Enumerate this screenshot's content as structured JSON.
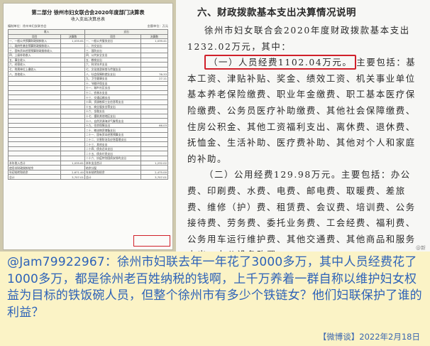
{
  "left_document": {
    "title": "第二部分 徐州市妇女联合会2020年度部门决算表",
    "subtitle": "收入支出决算总表",
    "meta_left": "编制单位：徐州市妇女联合会",
    "meta_right": "金额单位：万元",
    "header_income": "收入",
    "header_expense": "支出",
    "col_item": "项目",
    "col_row": "行次",
    "col_amount": "决算数",
    "rows": [
      {
        "income": "一、一般公共预算财政拨款收入",
        "income_amt": "1,035.61",
        "expense": "一、一般公共服务支出",
        "expense_amt": "1,039.41"
      },
      {
        "income": "二、政府性基金预算财政拨款收入",
        "income_amt": "",
        "expense": "二、外交支出",
        "expense_amt": ""
      },
      {
        "income": "三、国有资本经营预算财政拨款收入",
        "income_amt": "",
        "expense": "三、国防支出",
        "expense_amt": ""
      },
      {
        "income": "四、上级补助收入",
        "income_amt": "",
        "expense": "四、公共安全支出",
        "expense_amt": ""
      },
      {
        "income": "五、事业收入",
        "income_amt": "",
        "expense": "五、教育支出",
        "expense_amt": ""
      },
      {
        "income": "六、经营收入",
        "income_amt": "",
        "expense": "六、科学技术支出",
        "expense_amt": ""
      },
      {
        "income": "七、附属单位上缴收入",
        "income_amt": "",
        "expense": "七、文化旅游体育与传媒支出",
        "expense_amt": ""
      },
      {
        "income": "八、其他收入",
        "income_amt": "",
        "expense": "八、社会保障和就业支出",
        "expense_amt": "76.33"
      },
      {
        "income": "",
        "income_amt": "",
        "expense": "九、卫生健康支出",
        "expense_amt": "27.11"
      },
      {
        "income": "",
        "income_amt": "",
        "expense": "十、节能环保支出",
        "expense_amt": ""
      },
      {
        "income": "",
        "income_amt": "",
        "expense": "十一、城乡社区支出",
        "expense_amt": ""
      },
      {
        "income": "",
        "income_amt": "",
        "expense": "十二、农林水支出",
        "expense_amt": ""
      },
      {
        "income": "",
        "income_amt": "",
        "expense": "十三、交通运输支出",
        "expense_amt": ""
      },
      {
        "income": "",
        "income_amt": "",
        "expense": "十四、资源勘探工业信息等支出",
        "expense_amt": ""
      },
      {
        "income": "",
        "income_amt": "",
        "expense": "十五、商业服务业等支出",
        "expense_amt": ""
      },
      {
        "income": "",
        "income_amt": "",
        "expense": "十六、金融支出",
        "expense_amt": ""
      },
      {
        "income": "",
        "income_amt": "",
        "expense": "十七、援助其他地区支出",
        "expense_amt": ""
      },
      {
        "income": "",
        "income_amt": "",
        "expense": "十八、自然资源海洋气象等支出",
        "expense_amt": ""
      },
      {
        "income": "",
        "income_amt": "",
        "expense": "十九、住房保障支出",
        "expense_amt": "66.03"
      },
      {
        "income": "",
        "income_amt": "",
        "expense": "二十、粮油物资储备支出",
        "expense_amt": ""
      },
      {
        "income": "",
        "income_amt": "",
        "expense": "二十一、国有资本经营预算支出",
        "expense_amt": ""
      },
      {
        "income": "",
        "income_amt": "",
        "expense": "二十二、灾害防治及应急管理支出",
        "expense_amt": ""
      },
      {
        "income": "",
        "income_amt": "",
        "expense": "二十三、其他支出",
        "expense_amt": ""
      },
      {
        "income": "",
        "income_amt": "",
        "expense": "二十四、债务还本支出",
        "expense_amt": ""
      },
      {
        "income": "",
        "income_amt": "",
        "expense": "二十五、债务付息支出",
        "expense_amt": ""
      },
      {
        "income": "",
        "income_amt": "",
        "expense": "二十六、抗疫特别国债安排的支出",
        "expense_amt": ""
      },
      {
        "income": "本年收入合计",
        "income_amt": "1,035.61",
        "expense": "本年支出合计",
        "expense_amt": "1,232.02"
      },
      {
        "income": "使用非财政拨款结余",
        "income_amt": "",
        "expense": "结余分配",
        "expense_amt": ""
      },
      {
        "income": "年初结转和结余",
        "income_amt": "2,671.40",
        "expense": "年末结转和结余",
        "expense_amt": "2,475.00"
      },
      {
        "income": "总计",
        "income_amt": "3,707.01",
        "expense": "总计",
        "expense_amt": "3,707.01"
      }
    ]
  },
  "right_document": {
    "heading": "六、财政拨款基本支出决算情况说明",
    "para1": "徐州市妇女联合会2020年度财政拨款基本支出1232.02万元，其中：",
    "highlight": "（一）人员经费1102.04万元。",
    "para2_after_highlight": "主要包括：基本工资、津贴补贴、奖金、绩效工资、机关事业单位基本养老保险缴费、职业年金缴费、职工基本医疗保险缴费、公务员医疗补助缴费、其他社会保障缴费、住房公积金、其他工资福利支出、离休费、退休费、抚恤金、生活补助、医疗费补助、其他对个人和家庭的补助。",
    "para3": "（二）公用经费129.98万元。主要包括：办公费、印刷费、水费、电费、邮电费、取暖费、差旅费、维修（护）费、租赁费、会议费、培训费、公务接待费、劳务费、委托业务费、工会经费、福利费、公务用车运行维护费、其他交通费、其他商品和服务支出、办公设备购置。",
    "watermark": "@新"
  },
  "caption": {
    "text": "@Jam79922967：徐州市妇联去年一年花了3000多万，其中人员经费花了1000多万，都是徐州老百姓纳税的钱啊，上千万养着一群自称以维护妇女权益为目标的铁饭碗人员，但整个徐州市有多少个铁链女？他们妇联保护了谁的利益？",
    "source": "【微博谈】2022年2月18日"
  },
  "colors": {
    "highlight_border": "#d0202a",
    "caption_background": "#fbf3c6",
    "caption_text": "#2d62b8"
  }
}
